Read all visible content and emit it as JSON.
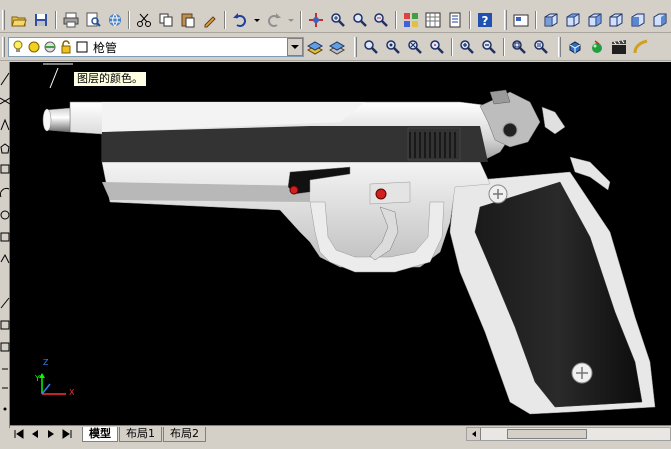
{
  "layer_combo": {
    "current_layer": "枪管"
  },
  "tooltip": {
    "text": "图层的颜色。"
  },
  "ucs": {
    "x_label": "X",
    "y_label": "Y",
    "z_label": "Z"
  },
  "layout_tabs": [
    {
      "label": "模型",
      "active": true
    },
    {
      "label": "布局1",
      "active": false
    },
    {
      "label": "布局2",
      "active": false
    }
  ],
  "colors": {
    "viewport_bg": "#000000",
    "model_light": "#e6e6e6",
    "grip_black": "#111111",
    "accent_red": "#d02020"
  }
}
